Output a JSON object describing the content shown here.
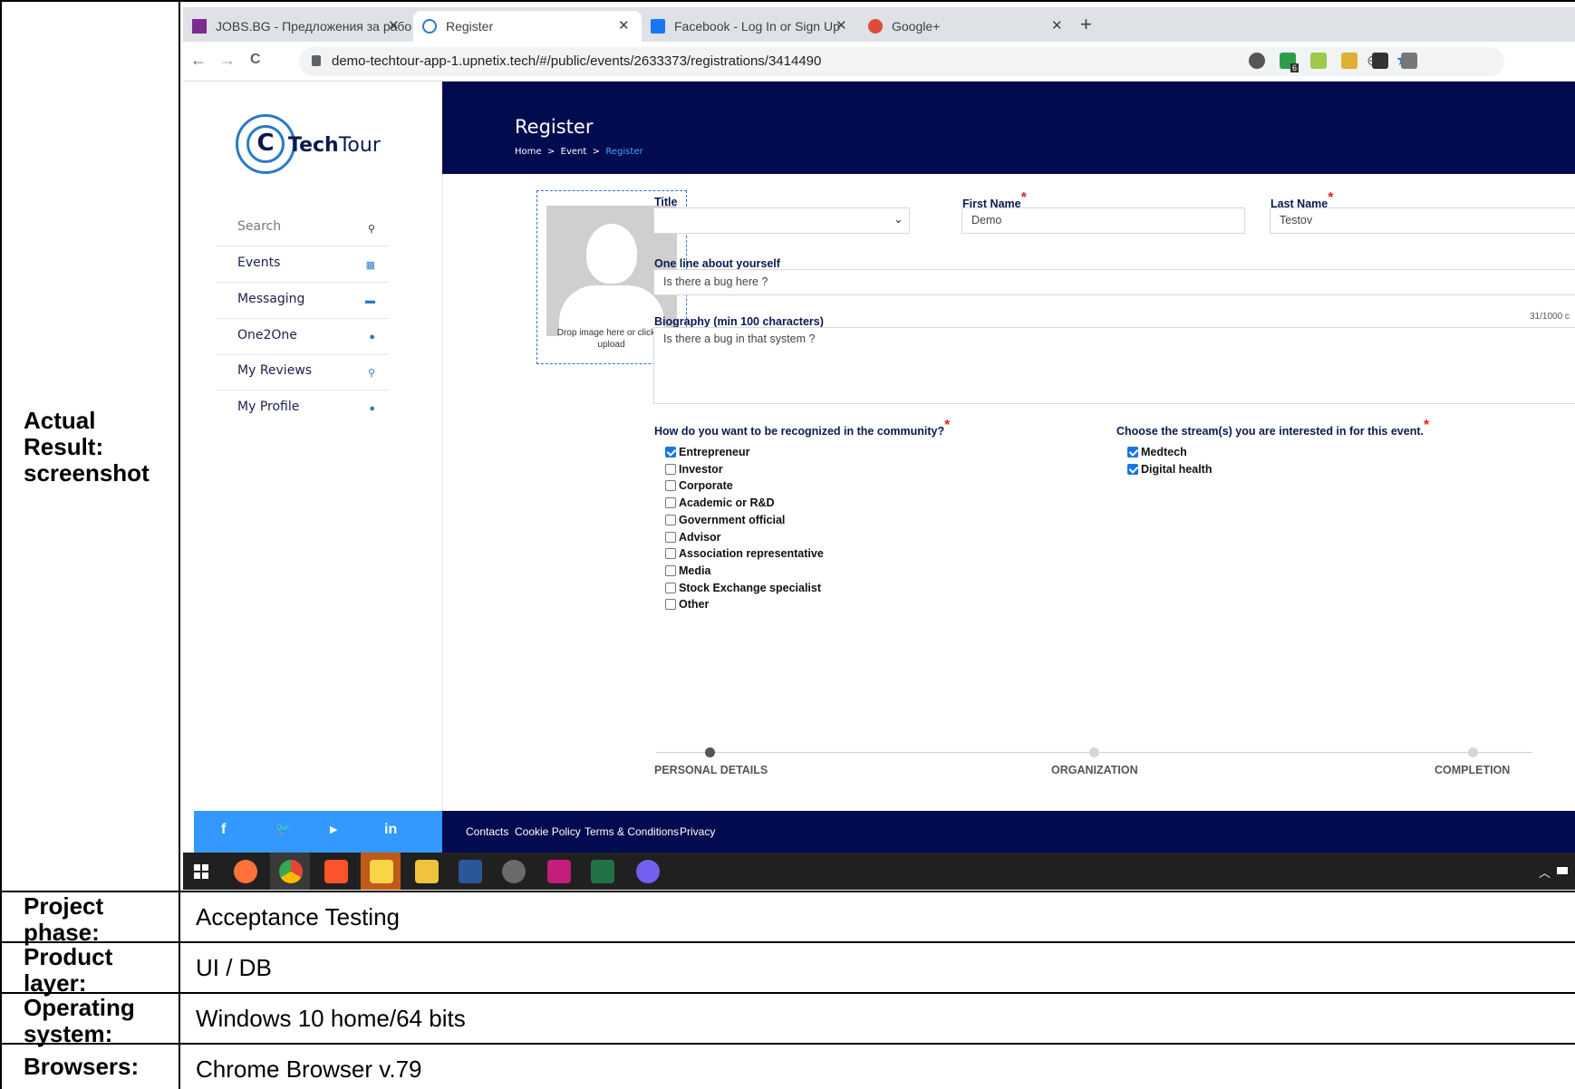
{
  "report": {
    "rows": [
      {
        "label": "Actual Result: screenshot",
        "value": ""
      },
      {
        "label": "Project phase:",
        "value": "Acceptance Testing"
      },
      {
        "label": "Product layer:",
        "value": "UI / DB"
      },
      {
        "label": "Operating system:",
        "value": "Windows 10 home/64 bits"
      },
      {
        "label": "Browsers:",
        "value": "Chrome Browser v.79"
      }
    ],
    "label_lines": {
      "actual": [
        "Actual",
        "Result:",
        "screenshot"
      ],
      "phase": [
        "Project",
        "phase:"
      ],
      "layer": [
        "Product",
        "layer:"
      ],
      "os": [
        "Operating",
        "system:"
      ],
      "browsers": [
        "Browsers:"
      ]
    }
  },
  "browser": {
    "tabs": [
      {
        "title": "JOBS.BG - Предложения за рабо",
        "close": "✕",
        "active": false,
        "favicon_color": "#7b2d8e"
      },
      {
        "title": "Register",
        "close": "✕",
        "active": true,
        "favicon_color": "#2a7ac7"
      },
      {
        "title": "Facebook - Log In or Sign Up",
        "close": "✕",
        "active": false,
        "favicon_color": "#1877f2"
      },
      {
        "title": "Google+",
        "close": "✕",
        "active": false,
        "favicon_color": "#dd4b39"
      }
    ],
    "new_tab": "+",
    "back": "←",
    "forward": "→",
    "reload": "C",
    "url": "demo-techtour-app-1.upnetix.tech/#/public/events/2633373/registrations/3414490",
    "zoom_icon": "⊕",
    "star": "★",
    "ext_badge": "6"
  },
  "app": {
    "logo": {
      "brand_bold": "Tech",
      "brand_light": "Tour",
      "mark": "C"
    },
    "nav": [
      {
        "label": "Search",
        "icon": "search-icon",
        "glyph": "⚲"
      },
      {
        "label": "Events",
        "icon": "calendar-icon",
        "glyph": "▦"
      },
      {
        "label": "Messaging",
        "icon": "chat-icon",
        "glyph": "▬"
      },
      {
        "label": "One2One",
        "icon": "user-icon",
        "glyph": "●"
      },
      {
        "label": "My Reviews",
        "icon": "search-icon",
        "glyph": "⚲"
      },
      {
        "label": "My Profile",
        "icon": "user-icon",
        "glyph": "●"
      }
    ],
    "header": {
      "title": "Register",
      "breadcrumb": [
        "Home",
        ">",
        "Event",
        ">",
        "Register"
      ]
    },
    "upload": {
      "text": "Drop image here or click to upload"
    },
    "form": {
      "title_label": "Title",
      "title_value": "",
      "first_name_label": "First Name",
      "first_name_value": "Demo",
      "last_name_label": "Last Name",
      "last_name_value": "Testov",
      "one_line_label": "One line about yourself",
      "one_line_value": "Is there a bug here ?",
      "bio_label": "Biography (min 100 characters)",
      "bio_value": "Is there a bug in that system ?",
      "bio_counter": "31/1000 c",
      "required_mark": "*"
    },
    "recognition": {
      "question": "How do you want to be recognized in the community?",
      "options": [
        {
          "label": "Entrepreneur",
          "checked": true
        },
        {
          "label": "Investor",
          "checked": false
        },
        {
          "label": "Corporate",
          "checked": false
        },
        {
          "label": "Academic or R&D",
          "checked": false
        },
        {
          "label": "Government official",
          "checked": false
        },
        {
          "label": "Advisor",
          "checked": false
        },
        {
          "label": "Association representative",
          "checked": false
        },
        {
          "label": "Media",
          "checked": false
        },
        {
          "label": "Stock Exchange specialist",
          "checked": false
        },
        {
          "label": "Other",
          "checked": false
        }
      ]
    },
    "streams": {
      "question": "Choose the stream(s) you are interested in for this event.",
      "options": [
        {
          "label": "Medtech",
          "checked": true
        },
        {
          "label": "Digital health",
          "checked": true
        }
      ]
    },
    "steps": [
      {
        "label": "PERSONAL DETAILS",
        "active": true
      },
      {
        "label": "ORGANIZATION",
        "active": false
      },
      {
        "label": "COMPLETION",
        "active": false
      }
    ],
    "social": [
      "f",
      "🐦",
      "▶",
      "in"
    ],
    "footer_links": [
      "Contacts",
      "Cookie Policy",
      "Terms & Conditions",
      "Privacy"
    ]
  },
  "colors": {
    "header_bg": "#020b4f",
    "social_bg": "#3399ff",
    "accent": "#2a7ac7",
    "required": "#e02424"
  }
}
